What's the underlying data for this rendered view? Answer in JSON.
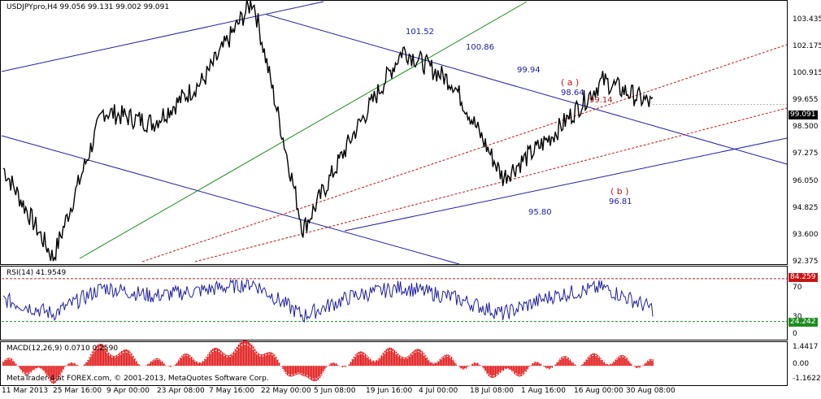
{
  "main_header": "USDJPYpro,H4  99.056 99.131 99.002 99.091",
  "rsi_header": "RSI(14) 41.9549",
  "macd_header": "MACD(12,26,9) 0.0710 0.2590",
  "copyright": "MetaTrader 4 at FOREX.com, © 2001-2013, MetaQuotes Software Corp.",
  "price_axis": [
    "103.435",
    "102.175",
    "100.915",
    "99.655",
    "98.500",
    "97.275",
    "96.050",
    "94.825",
    "93.600",
    "92.375"
  ],
  "current_price": "99.091",
  "rsi_axis": [
    "70",
    "30",
    "0"
  ],
  "rsi_levels": {
    "upper": "84.259",
    "lower": "24.242"
  },
  "macd_axis": [
    "1.4417",
    "0.00",
    "-1.1622"
  ],
  "time_axis": [
    "11 Mar 2013",
    "25 Mar 16:00",
    "9 Apr 00:00",
    "23 Apr 08:00",
    "7 May 16:00",
    "22 May 00:00",
    "5 Jun 08:00",
    "19 Jun 16:00",
    "4 Jul 00:00",
    "18 Jul 08:00",
    "1 Aug 16:00",
    "16 Aug 00:00",
    "30 Aug 08:00"
  ],
  "annotations": [
    {
      "text": "101.52",
      "color": "#1a1aa6"
    },
    {
      "text": "100.86",
      "color": "#1a1aa6"
    },
    {
      "text": "99.94",
      "color": "#1a1aa6"
    },
    {
      "text": "98.64",
      "color": "#1a1aa6"
    },
    {
      "text": "99.14",
      "color": "#a01818"
    },
    {
      "text": "( a )",
      "color": "#c81414"
    },
    {
      "text": "( b )",
      "color": "#c81414"
    },
    {
      "text": "96.81",
      "color": "#1a1aa6"
    },
    {
      "text": "95.80",
      "color": "#1a1aa6"
    }
  ],
  "colors": {
    "price": "#000000",
    "channel": "#1f1fa0",
    "green": "#1e8c1e",
    "dotted": "#b41e1e",
    "rsi": "#1f1f9c",
    "macd": "#e01010",
    "signal": "#ffffff",
    "current_tag": "#000000",
    "rsi_upper_tag": "#c81414",
    "rsi_lower_tag": "#1e8c1e"
  },
  "chart_data": [
    {
      "type": "line",
      "title": "USDJPYpro,H4",
      "ylim": [
        92.375,
        103.435
      ],
      "x": [
        "11 Mar 2013",
        "25 Mar",
        "9 Apr",
        "23 Apr",
        "7 May",
        "22 May",
        "5 Jun",
        "19 Jun",
        "4 Jul",
        "18 Jul",
        "1 Aug",
        "16 Aug",
        "30 Aug",
        "latest"
      ],
      "series": [
        {
          "name": "USDJPYpro,H4",
          "values": [
            96.4,
            92.6,
            98.8,
            98.3,
            100.1,
            103.5,
            93.8,
            97.8,
            101.4,
            100.0,
            96.0,
            97.8,
            100.1,
            99.09
          ]
        }
      ]
    },
    {
      "type": "line",
      "title": "RSI(14)",
      "ylim": [
        0,
        100
      ],
      "levels": [
        84.259,
        24.242
      ],
      "series": [
        {
          "name": "RSI(14)",
          "values": [
            55,
            35,
            72,
            60,
            68,
            78,
            32,
            60,
            72,
            58,
            35,
            60,
            72,
            41.95
          ]
        }
      ]
    },
    {
      "type": "area",
      "title": "MACD(12,26,9)",
      "ylim": [
        -1.1622,
        1.4417
      ],
      "series": [
        {
          "name": "MACD(12,26,9)",
          "values": [
            0.3,
            -0.8,
            1.2,
            0.1,
            0.6,
            1.4,
            -1.0,
            0.5,
            0.9,
            0.3,
            -0.6,
            0.2,
            0.5,
            0.071
          ]
        }
      ]
    }
  ]
}
